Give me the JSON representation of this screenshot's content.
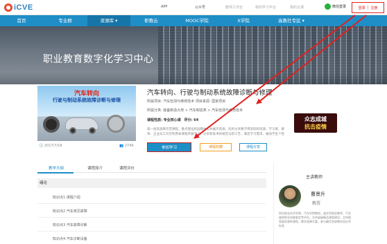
{
  "topbar": {
    "logo_text": "iCVE",
    "links": [
      "APP",
      "公众号",
      "教师工作台",
      "我的学习平台",
      "我的云课"
    ],
    "wechat_label": "微信登录",
    "login_label": "登录",
    "divider": "|",
    "register_label": "注册"
  },
  "nav": {
    "items": [
      "首页",
      "专业群",
      "资源库 ▾",
      "职教云",
      "MOOC学院",
      "X学院",
      "高教社专区 ▾"
    ],
    "active_index": 2
  },
  "banner": {
    "title": "职业教育数字化学习中心"
  },
  "course": {
    "cover_title_1": "汽车转向",
    "cover_title_2": "行驶与制动系统故障诊断与修理",
    "date": "2017/7/18",
    "views": "2749",
    "title": "汽车转向、行驶与制动系统故障诊断与修理",
    "project_line": "所属项目: 汽车检测与维修技术   项目来源: 国家项目",
    "category_line": "所属分类: 装备制造大类 > 汽车制造类 > 汽车检测与维修技术",
    "type_label": "课程性质: 专业核心课",
    "score_label": "评分: 64",
    "description": "第一批资源库示范课程，重点建设校园网中实体展示资源，同步分享教学用资料和资源，学习者、教师、企业员工均可利用本课程开展学习，分享新技术新规范与新工艺，满足学习需求，推动学生个性化学习和教师教学内容改革创新建设",
    "join_button": "参加学习",
    "fav_button": "课程收藏",
    "share_button": "课程分享"
  },
  "promo": {
    "line1": "众志成城",
    "line2": "抗击疫情"
  },
  "tabs": {
    "items": [
      "教学大纲",
      "课程简介",
      "课程评价"
    ],
    "active_index": 0
  },
  "syllabus": {
    "section": "绪论",
    "items": [
      "知识点1 课程介绍",
      "知识点2 汽车常见故障",
      "知识点3 汽车故障诊断",
      "知识点4 汽车诊断设备"
    ]
  },
  "teacher": {
    "heading": "主讲教师",
    "name": "曹景升",
    "role": "教授",
    "bio": "邢台职业技术学院，汽车学院教授，省优秀指导教师，汽车维修职业技能鉴定考评员，主持省级精品课程建设，主持国家级资源库课程，教学成果丰富，参与编写多部教材及技术标准"
  },
  "colors": {
    "nav_blue": "#1f8ec7",
    "annotation_red": "#e02020",
    "brand_orange": "#e84a2e"
  }
}
